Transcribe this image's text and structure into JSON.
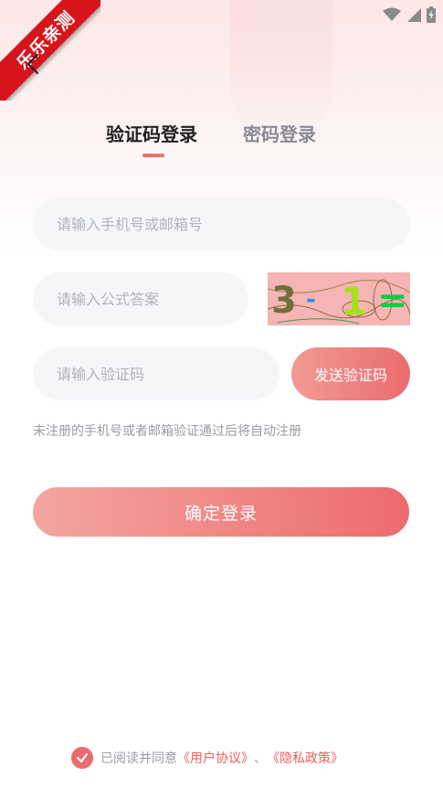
{
  "ribbon": {
    "text": "乐乐亲测"
  },
  "tabs": [
    {
      "label": "验证码登录",
      "active": true
    },
    {
      "label": "密码登录",
      "active": false
    }
  ],
  "form": {
    "phone_placeholder": "请输入手机号或邮箱号",
    "formula_placeholder": "请输入公式答案",
    "code_placeholder": "请输入验证码",
    "send_code_label": "发送验证码",
    "captcha_text": [
      "3",
      "-",
      "1",
      "="
    ]
  },
  "hint": "未注册的手机号或者邮箱验证通过后将自动注册",
  "login_label": "确定登录",
  "agreement": {
    "prefix": "已阅读并同意",
    "user_agreement": "《用户协议》",
    "separator": "、",
    "privacy_policy": "《隐私政策》"
  },
  "colors": {
    "accent": "#ec6b6f",
    "tab_indicator": "#ec7171",
    "ribbon": "#d7141c"
  },
  "icons": {
    "back": "back-arrow-icon",
    "wifi": "wifi-icon",
    "signal": "signal-icon",
    "battery": "battery-icon",
    "check": "check-icon"
  }
}
